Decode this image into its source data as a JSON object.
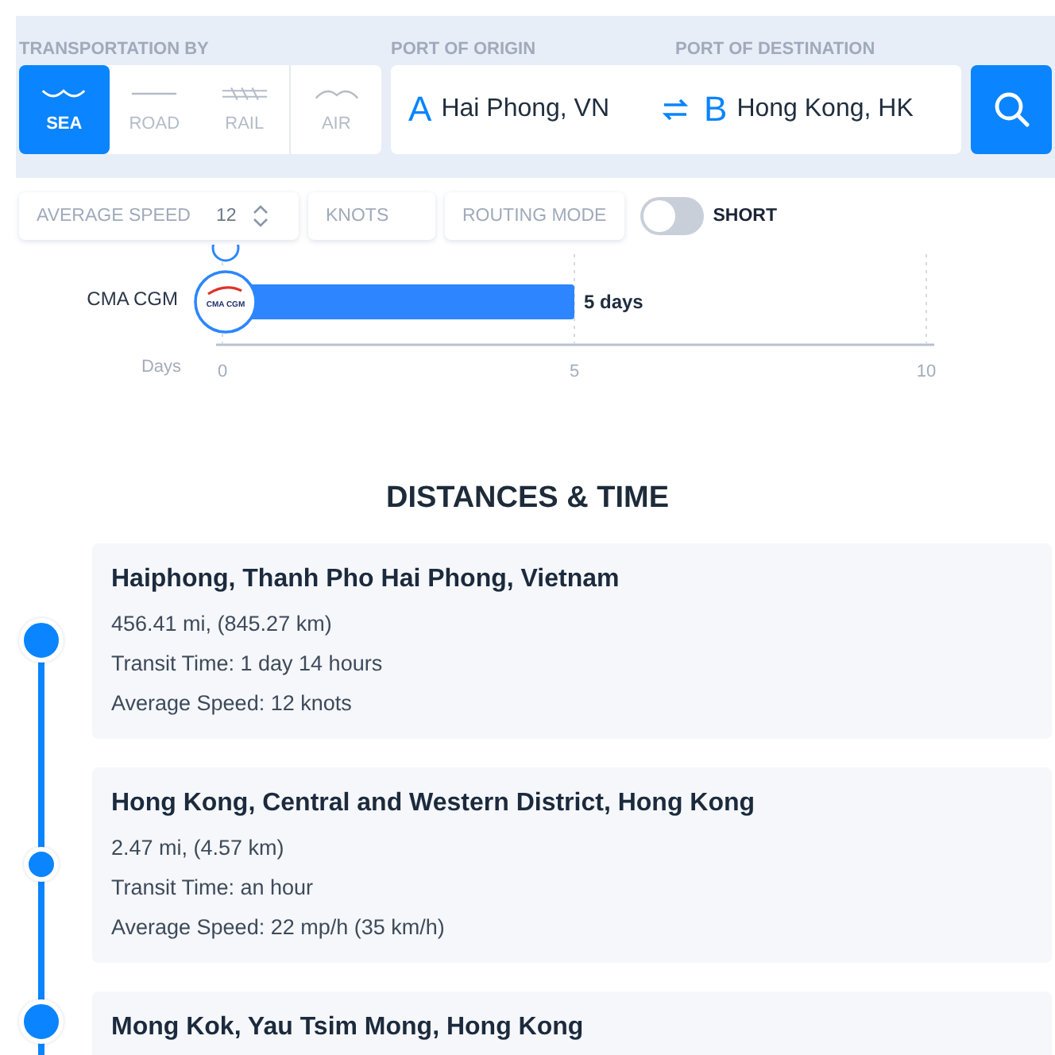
{
  "transport": {
    "label": "TRANSPORTATION BY",
    "modes": [
      {
        "kind": "sea",
        "label": "SEA",
        "selected": true
      },
      {
        "kind": "road",
        "label": "ROAD",
        "selected": false
      },
      {
        "kind": "rail",
        "label": "RAIL",
        "selected": false
      },
      {
        "kind": "air",
        "label": "AIR",
        "selected": false
      }
    ]
  },
  "origin": {
    "label": "PORT OF ORIGIN",
    "marker": "A",
    "value": "Hai Phong, VN"
  },
  "destination": {
    "label": "PORT OF DESTINATION",
    "marker": "B",
    "value": "Hong Kong, HK"
  },
  "options": {
    "speed_label": "AVERAGE SPEED",
    "speed_value": "12",
    "unit": "KNOTS",
    "routing_label": "ROUTING MODE",
    "routing_toggle": {
      "on": false,
      "label": "SHORT"
    }
  },
  "chart": {
    "logo": "CMA CGM",
    "chart_data": {
      "type": "bar",
      "orientation": "horizontal",
      "xlabel": "Days",
      "categories": [
        "CMA CGM"
      ],
      "values": [
        5
      ],
      "xlim": [
        0,
        10
      ],
      "xticks": [
        0,
        5,
        10
      ],
      "value_labels": [
        "5 days"
      ]
    }
  },
  "section_title": "DISTANCES & TIME",
  "stops": [
    {
      "kind": "endpoint",
      "name": "Haiphong, Thanh Pho Hai Phong, Vietnam",
      "lines": [
        "456.41 mi, (845.27 km)",
        "Transit Time: 1 day 14 hours",
        "Average Speed: 12 knots"
      ]
    },
    {
      "kind": "waypoint",
      "name": "Hong Kong, Central and Western District, Hong Kong",
      "lines": [
        "2.47 mi, (4.57 km)",
        "Transit Time: an hour",
        "Average Speed: 22 mp/h (35 km/h)"
      ]
    },
    {
      "kind": "endpoint",
      "name": "Mong Kok, Yau Tsim Mong, Hong Kong"
    }
  ]
}
